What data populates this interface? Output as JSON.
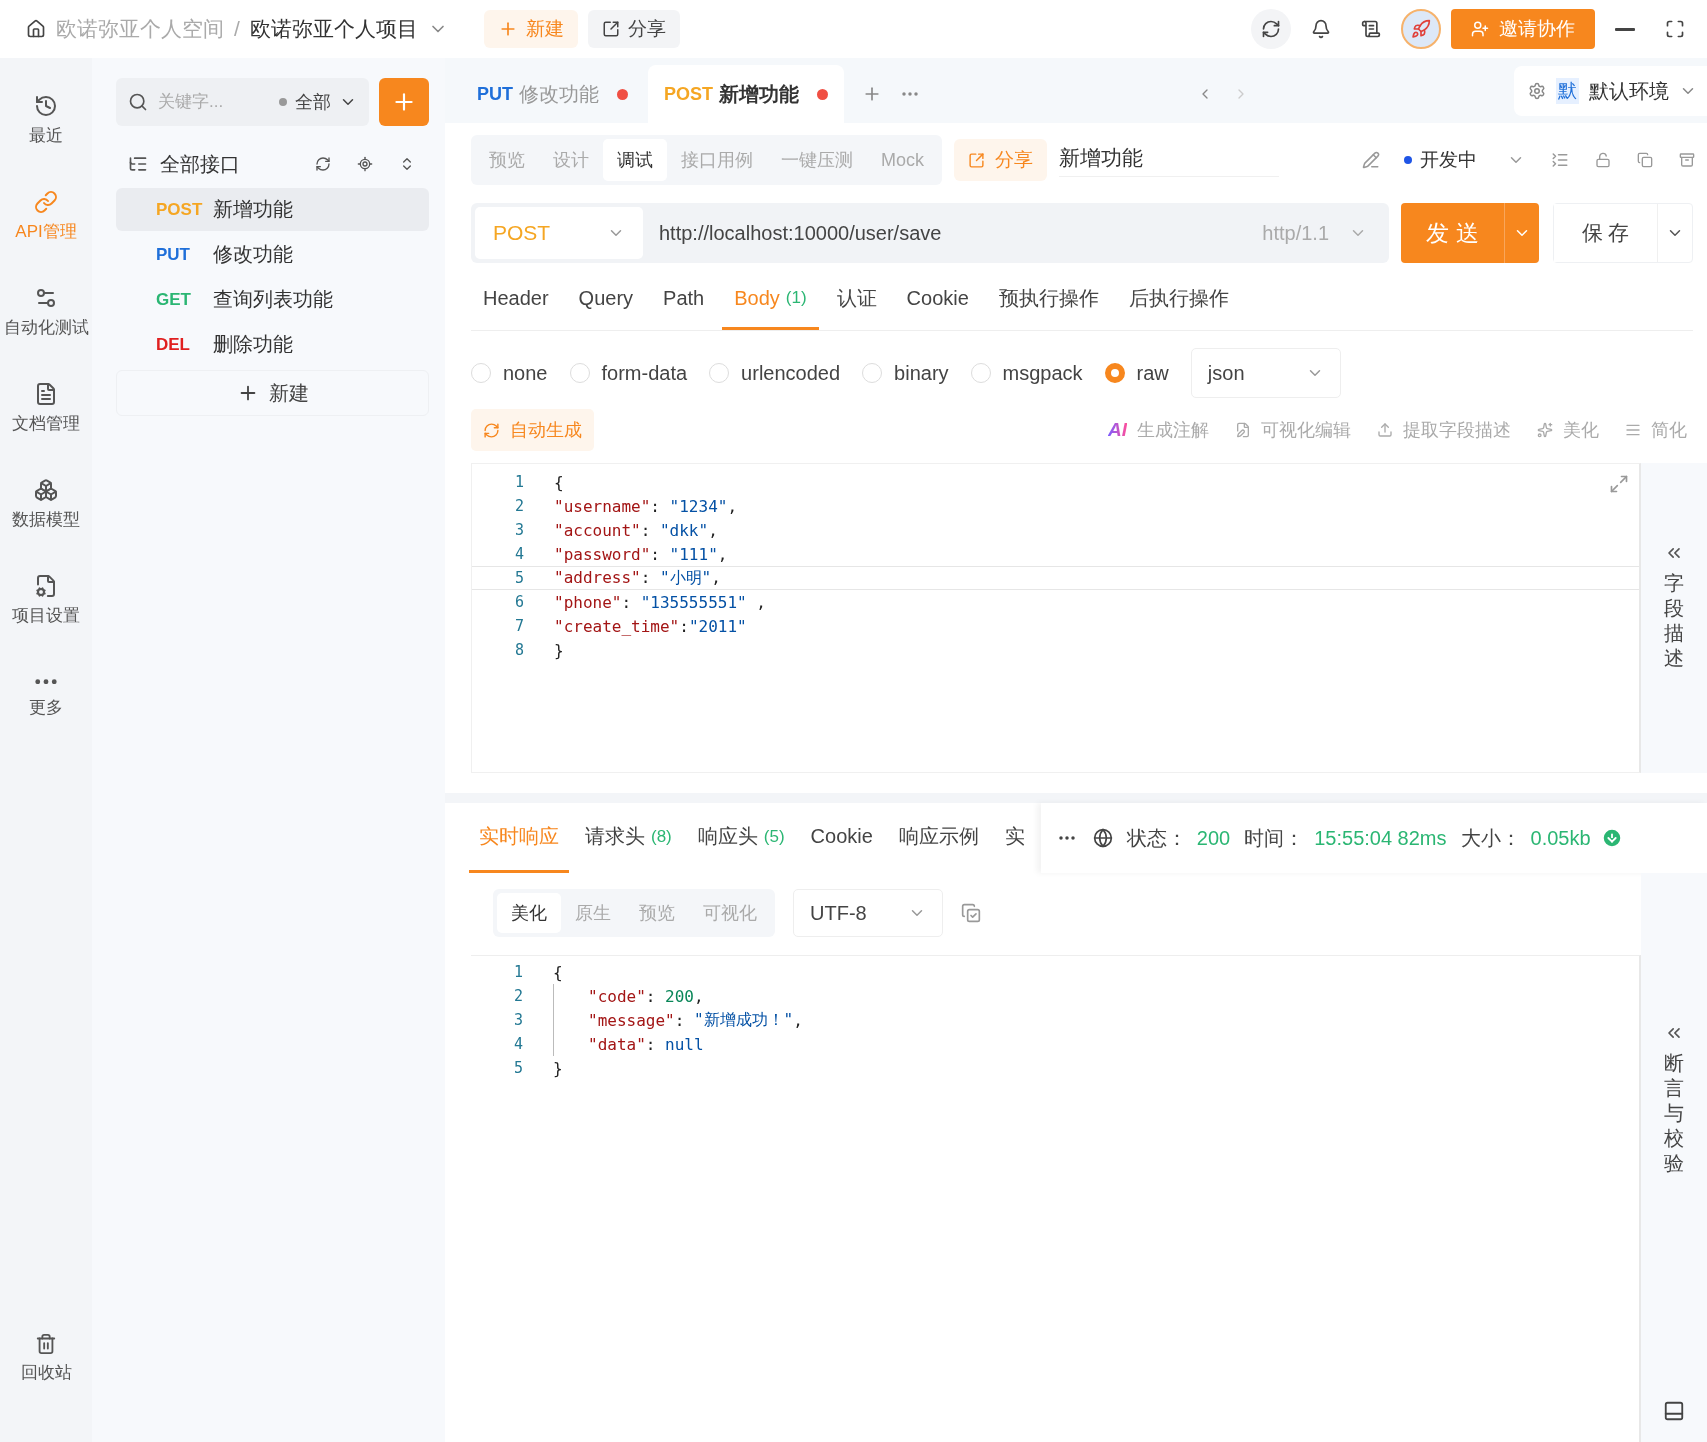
{
  "breadcrumb": {
    "workspace": "欧诺弥亚个人空间",
    "separator": "/",
    "project": "欧诺弥亚个人项目"
  },
  "header_buttons": [
    {
      "label": "新建",
      "kind": "new"
    },
    {
      "label": "分享",
      "kind": "share"
    }
  ],
  "invite_button": "邀请协作",
  "nav": [
    {
      "label": "最近",
      "selected": false
    },
    {
      "label": "API管理",
      "selected": true
    },
    {
      "label": "自动化测试",
      "selected": false
    },
    {
      "label": "文档管理",
      "selected": false
    },
    {
      "label": "数据模型",
      "selected": false
    },
    {
      "label": "项目设置",
      "selected": false
    },
    {
      "label": "更多",
      "selected": false
    }
  ],
  "nav_bottom": "回收站",
  "api_panel": {
    "search_placeholder": "关键字...",
    "filter": "全部",
    "root": "全部接口",
    "new_label": "新建",
    "items": [
      {
        "method": "POST",
        "name": "新增功能",
        "color": "#f5a623",
        "selected": true
      },
      {
        "method": "PUT",
        "name": "修改功能",
        "color": "#1f6fd9",
        "selected": false
      },
      {
        "method": "GET",
        "name": "查询列表功能",
        "color": "#2bb673",
        "selected": false
      },
      {
        "method": "DEL",
        "name": "删除功能",
        "color": "#e02020",
        "selected": false
      }
    ]
  },
  "tabs": [
    {
      "method": "PUT",
      "name": "修改功能",
      "color": "#1f6fd9",
      "selected": false
    },
    {
      "method": "POST",
      "name": "新增功能",
      "color": "#f5a623",
      "selected": true
    }
  ],
  "environment": {
    "badge": "默",
    "name": "默认环境"
  },
  "view_tabs": [
    {
      "label": "预览",
      "selected": false
    },
    {
      "label": "设计",
      "selected": false
    },
    {
      "label": "调试",
      "selected": true
    },
    {
      "label": "接口用例",
      "selected": false
    },
    {
      "label": "一键压测",
      "selected": false
    },
    {
      "label": "Mock",
      "selected": false
    }
  ],
  "share_label": "分享",
  "api_name": "新增功能",
  "status": "开发中",
  "request": {
    "method": "POST",
    "url": "http://localhost:10000/user/save",
    "protocol": "http/1.1",
    "send": "发 送",
    "save": "保 存"
  },
  "param_tabs": [
    {
      "label": "Header",
      "selected": false
    },
    {
      "label": "Query",
      "selected": false
    },
    {
      "label": "Path",
      "selected": false
    },
    {
      "label": "Body",
      "count": "(1)",
      "selected": true
    },
    {
      "label": "认证",
      "selected": false
    },
    {
      "label": "Cookie",
      "selected": false
    },
    {
      "label": "预执行操作",
      "selected": false
    },
    {
      "label": "后执行操作",
      "selected": false
    }
  ],
  "body_types": [
    {
      "label": "none",
      "selected": false
    },
    {
      "label": "form-data",
      "selected": false
    },
    {
      "label": "urlencoded",
      "selected": false
    },
    {
      "label": "binary",
      "selected": false
    },
    {
      "label": "msgpack",
      "selected": false
    },
    {
      "label": "raw",
      "selected": true
    }
  ],
  "format": "json",
  "auto_generate": "自动生成",
  "ai_badge": "AI",
  "tools": [
    "生成注解",
    "可视化编辑",
    "提取字段描述",
    "美化",
    "简化"
  ],
  "request_body": [
    {
      "number": "1",
      "active": false,
      "tokens": [
        {
          "kind": "punct",
          "text": "{"
        }
      ]
    },
    {
      "number": "2",
      "active": false,
      "tokens": [
        {
          "kind": "key",
          "text": "\"username\""
        },
        {
          "kind": "punct",
          "text": ": "
        },
        {
          "kind": "str",
          "text": "\"1234\""
        },
        {
          "kind": "punct",
          "text": ","
        }
      ]
    },
    {
      "number": "3",
      "active": false,
      "tokens": [
        {
          "kind": "key",
          "text": "\"account\""
        },
        {
          "kind": "punct",
          "text": ": "
        },
        {
          "kind": "str",
          "text": "\"dkk\""
        },
        {
          "kind": "punct",
          "text": ","
        }
      ]
    },
    {
      "number": "4",
      "active": false,
      "tokens": [
        {
          "kind": "key",
          "text": "\"password\""
        },
        {
          "kind": "punct",
          "text": ": "
        },
        {
          "kind": "str",
          "text": "\"111\""
        },
        {
          "kind": "punct",
          "text": ","
        }
      ]
    },
    {
      "number": "5",
      "active": true,
      "tokens": [
        {
          "kind": "key",
          "text": "\"address\""
        },
        {
          "kind": "punct",
          "text": ": "
        },
        {
          "kind": "str",
          "text": "\"小明\""
        },
        {
          "kind": "punct",
          "text": ","
        }
      ]
    },
    {
      "number": "6",
      "active": false,
      "tokens": [
        {
          "kind": "key",
          "text": "\"phone\""
        },
        {
          "kind": "punct",
          "text": ": "
        },
        {
          "kind": "str",
          "text": "\"135555551\""
        },
        {
          "kind": "punct",
          "text": " ,"
        }
      ]
    },
    {
      "number": "7",
      "active": false,
      "tokens": [
        {
          "kind": "key",
          "text": "\"create_time\""
        },
        {
          "kind": "punct",
          "text": ":"
        },
        {
          "kind": "str",
          "text": "\"2011\""
        }
      ]
    },
    {
      "number": "8",
      "active": false,
      "tokens": [
        {
          "kind": "punct",
          "text": "}"
        }
      ]
    }
  ],
  "side_panels": [
    "字段描述",
    "断言与校验"
  ],
  "response_tabs": [
    {
      "label": "实时响应",
      "selected": true
    },
    {
      "label": "请求头",
      "count": "(8)",
      "selected": false
    },
    {
      "label": "响应头",
      "count": "(5)",
      "selected": false
    },
    {
      "label": "Cookie",
      "selected": false
    },
    {
      "label": "响应示例",
      "selected": false
    },
    {
      "label": "实",
      "selected": false
    }
  ],
  "response_meta": {
    "status_label": "状态：",
    "status": "200",
    "time_label": "时间：",
    "time": "15:55:04 82ms",
    "size_label": "大小：",
    "size": "0.05kb"
  },
  "view_modes": [
    {
      "label": "美化",
      "selected": true
    },
    {
      "label": "原生",
      "selected": false
    },
    {
      "label": "预览",
      "selected": false
    },
    {
      "label": "可视化",
      "selected": false
    }
  ],
  "encoding": "UTF-8",
  "response_body": [
    {
      "number": "1",
      "tokens": [
        {
          "kind": "punct",
          "text": "{"
        }
      ]
    },
    {
      "number": "2",
      "indented": true,
      "tokens": [
        {
          "kind": "key",
          "text": "\"code\""
        },
        {
          "kind": "punct",
          "text": ": "
        },
        {
          "kind": "num",
          "text": "200"
        },
        {
          "kind": "punct",
          "text": ","
        }
      ]
    },
    {
      "number": "3",
      "indented": true,
      "tokens": [
        {
          "kind": "key",
          "text": "\"message\""
        },
        {
          "kind": "punct",
          "text": ": "
        },
        {
          "kind": "str",
          "text": "\"新增成功！\""
        },
        {
          "kind": "punct",
          "text": ","
        }
      ]
    },
    {
      "number": "4",
      "indented": true,
      "tokens": [
        {
          "kind": "key",
          "text": "\"data\""
        },
        {
          "kind": "punct",
          "text": ": "
        },
        {
          "kind": "kw",
          "text": "null"
        }
      ]
    },
    {
      "number": "5",
      "tokens": [
        {
          "kind": "punct",
          "text": "}"
        }
      ]
    }
  ]
}
